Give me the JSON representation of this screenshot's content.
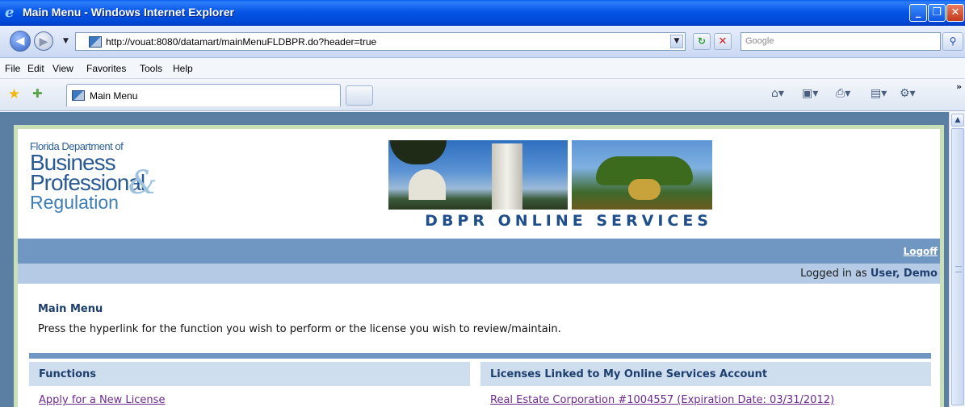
{
  "window": {
    "title": "Main Menu - Windows Internet Explorer"
  },
  "addressbar": {
    "url": "http://vouat:8080/datamart/mainMenuFLDBPR.do?header=true",
    "search_placeholder": "Google"
  },
  "menubar": {
    "items": [
      "File",
      "Edit",
      "View",
      "Favorites",
      "Tools",
      "Help"
    ]
  },
  "tabs": [
    {
      "label": "Main Menu"
    }
  ],
  "page": {
    "logo": {
      "line1": "Florida Department of",
      "line2": "Business",
      "line3": "Professional",
      "line4": "Regulation",
      "amp": "&"
    },
    "banner_caption": "DBPR ONLINE SERVICES",
    "logoff_label": "Logoff",
    "logged_in_prefix": "Logged in as",
    "logged_in_user": "User, Demo",
    "menu_title": "Main Menu",
    "instructions": "Press the hyperlink for the function you wish to perform or the license you wish to review/maintain.",
    "functions_header": "Functions",
    "licenses_header": "Licenses Linked to My Online Services Account",
    "functions": [
      {
        "label": "Apply for a New License"
      }
    ],
    "licenses": [
      {
        "label": "Real Estate Corporation #1004557 (Expiration Date: 03/31/2012)"
      }
    ]
  },
  "colors": {
    "title_bar": "#0756e6",
    "header_bar": "#6f97c2",
    "subheader_bar": "#b5cbe5",
    "column_header": "#cfdeef",
    "heading_text": "#1c3f6e",
    "visited_link": "#6d2a8e",
    "frame_green": "#c9e0b7"
  }
}
